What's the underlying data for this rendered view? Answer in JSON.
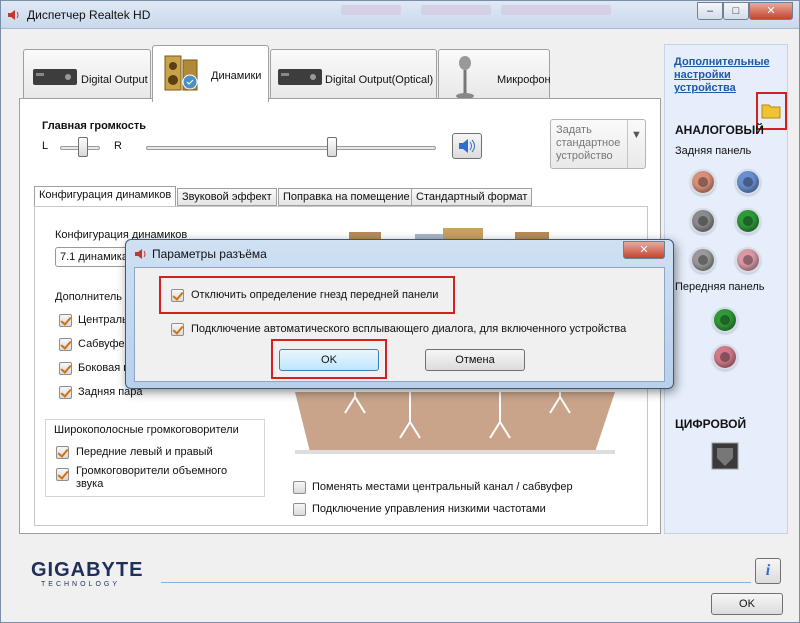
{
  "window": {
    "title": "Диспетчер Realtek HD"
  },
  "tabs": [
    {
      "label": "Digital Output"
    },
    {
      "label": "Динамики"
    },
    {
      "label": "Digital Output(Optical)"
    },
    {
      "label": "Микрофон"
    }
  ],
  "volume": {
    "title": "Главная громкость",
    "left_label": "L",
    "right_label": "R",
    "set_default_label": "Задать стандартное устройство"
  },
  "subtabs": [
    {
      "label": "Конфигурация динамиков"
    },
    {
      "label": "Звуковой эффект"
    },
    {
      "label": "Поправка на помещение"
    },
    {
      "label": "Стандартный формат"
    }
  ],
  "speaker_config": {
    "label": "Конфигурация динамиков",
    "selected": "7.1 динамика"
  },
  "extra_speakers": {
    "title": "Дополнитель",
    "items": [
      {
        "label": "Централь",
        "checked": true
      },
      {
        "label": "Сабвуфер",
        "checked": true
      },
      {
        "label": "Боковая п",
        "checked": true
      },
      {
        "label": "Задняя пара",
        "checked": true
      }
    ]
  },
  "fullrange": {
    "title": "Широкополосные громкоговорители",
    "items": [
      {
        "label": "Передние левый и правый",
        "checked": true
      },
      {
        "label": "Громкоговорители объемного звука",
        "checked": true
      }
    ]
  },
  "bottom_options": [
    {
      "label": "Поменять местами центральный канал / сабвуфер",
      "checked": false
    },
    {
      "label": "Подключение управления низкими частотами",
      "checked": false
    }
  ],
  "sidebar": {
    "advanced_link": "Дополнительные настройки устройства",
    "analog_title": "АНАЛОГОВЫЙ",
    "back_panel": "Задняя панель",
    "front_panel": "Передняя панель",
    "digital_title": "ЦИФРОВОЙ"
  },
  "footer": {
    "brand": "GIGABYTE",
    "brand_sub": "TECHNOLOGY",
    "ok": "OK",
    "info_icon": "i"
  },
  "dialog": {
    "title": "Параметры разъёма",
    "option1": "Отключить определение гнезд передней панели",
    "option1_checked": true,
    "option2": "Подключение автоматического всплывающего диалога, для включенного устройства",
    "option2_checked": true,
    "ok": "OK",
    "cancel": "Отмена"
  },
  "colors": {
    "jack_back": [
      "#d9907a",
      "#6a8fd0",
      "#8c8c8c",
      "#2f9a3a",
      "#9a9a9a",
      "#d99aa6"
    ],
    "jack_front": [
      "#2f9a3a",
      "#d07a8a"
    ],
    "accent": "#d32020"
  }
}
